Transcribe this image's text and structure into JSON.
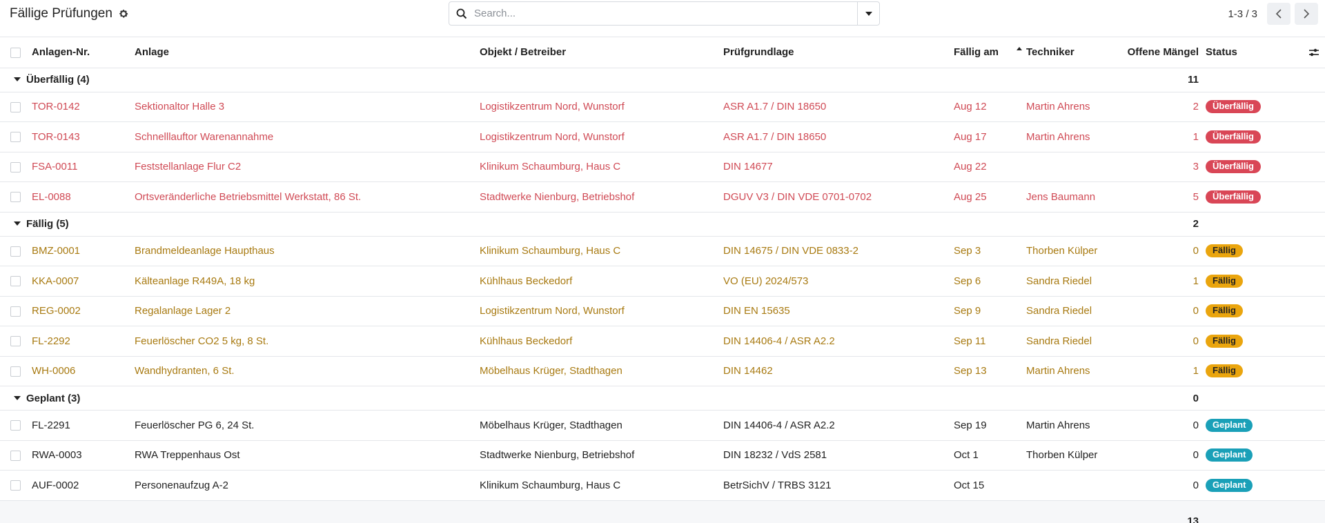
{
  "header": {
    "title": "Fällige Prüfungen",
    "search_placeholder": "Search...",
    "pager_value": "1-3 / 3"
  },
  "columns": {
    "asset_no": "Anlagen-Nr.",
    "asset": "Anlage",
    "site": "Objekt / Betreiber",
    "basis": "Prüfgrundlage",
    "due": "Fällig am",
    "tech": "Techniker",
    "defects": "Offene Mängel",
    "status": "Status"
  },
  "groups": [
    {
      "label": "Überfällig (4)",
      "total": "11",
      "rows": [
        {
          "no": "TOR-0142",
          "asset": "Sektionaltor Halle 3",
          "site": "Logistikzentrum Nord, Wunstorf",
          "basis": "ASR A1.7 / DIN 18650",
          "due": "Aug 12",
          "tech": "Martin Ahrens",
          "defects": "2",
          "status": "Überfällig"
        },
        {
          "no": "TOR-0143",
          "asset": "Schnelllauftor Warenannahme",
          "site": "Logistikzentrum Nord, Wunstorf",
          "basis": "ASR A1.7 / DIN 18650",
          "due": "Aug 17",
          "tech": "Martin Ahrens",
          "defects": "1",
          "status": "Überfällig"
        },
        {
          "no": "FSA-0011",
          "asset": "Feststellanlage Flur C2",
          "site": "Klinikum Schaumburg, Haus C",
          "basis": "DIN 14677",
          "due": "Aug 22",
          "tech": "",
          "defects": "3",
          "status": "Überfällig"
        },
        {
          "no": "EL-0088",
          "asset": "Ortsveränderliche Betriebsmittel Werkstatt, 86 St.",
          "site": "Stadtwerke Nienburg, Betriebshof",
          "basis": "DGUV V3 / DIN VDE 0701-0702",
          "due": "Aug 25",
          "tech": "Jens Baumann",
          "defects": "5",
          "status": "Überfällig"
        }
      ]
    },
    {
      "label": "Fällig (5)",
      "total": "2",
      "rows": [
        {
          "no": "BMZ-0001",
          "asset": "Brandmeldeanlage Haupthaus",
          "site": "Klinikum Schaumburg, Haus C",
          "basis": "DIN 14675 / DIN VDE 0833-2",
          "due": "Sep 3",
          "tech": "Thorben Külper",
          "defects": "0",
          "status": "Fällig"
        },
        {
          "no": "KKA-0007",
          "asset": "Kälteanlage R449A, 18 kg",
          "site": "Kühlhaus Beckedorf",
          "basis": "VO (EU) 2024/573",
          "due": "Sep 6",
          "tech": "Sandra Riedel",
          "defects": "1",
          "status": "Fällig"
        },
        {
          "no": "REG-0002",
          "asset": "Regalanlage Lager 2",
          "site": "Logistikzentrum Nord, Wunstorf",
          "basis": "DIN EN 15635",
          "due": "Sep 9",
          "tech": "Sandra Riedel",
          "defects": "0",
          "status": "Fällig"
        },
        {
          "no": "FL-2292",
          "asset": "Feuerlöscher CO2 5 kg, 8 St.",
          "site": "Kühlhaus Beckedorf",
          "basis": "DIN 14406-4 / ASR A2.2",
          "due": "Sep 11",
          "tech": "Sandra Riedel",
          "defects": "0",
          "status": "Fällig"
        },
        {
          "no": "WH-0006",
          "asset": "Wandhydranten, 6 St.",
          "site": "Möbelhaus Krüger, Stadthagen",
          "basis": "DIN 14462",
          "due": "Sep 13",
          "tech": "Martin Ahrens",
          "defects": "1",
          "status": "Fällig"
        }
      ]
    },
    {
      "label": "Geplant (3)",
      "total": "0",
      "rows": [
        {
          "no": "FL-2291",
          "asset": "Feuerlöscher PG 6, 24 St.",
          "site": "Möbelhaus Krüger, Stadthagen",
          "basis": "DIN 14406-4 / ASR A2.2",
          "due": "Sep 19",
          "tech": "Martin Ahrens",
          "defects": "0",
          "status": "Geplant"
        },
        {
          "no": "RWA-0003",
          "asset": "RWA Treppenhaus Ost",
          "site": "Stadtwerke Nienburg, Betriebshof",
          "basis": "DIN 18232 / VdS 2581",
          "due": "Oct 1",
          "tech": "Thorben Külper",
          "defects": "0",
          "status": "Geplant"
        },
        {
          "no": "AUF-0002",
          "asset": "Personenaufzug A-2",
          "site": "Klinikum Schaumburg, Haus C",
          "basis": "BetrSichV / TRBS 3121",
          "due": "Oct 15",
          "tech": "",
          "defects": "0",
          "status": "Geplant"
        }
      ]
    }
  ],
  "footer_total": "13",
  "colors": {
    "overdue": "#d04a55",
    "due": "#a87a11",
    "planned_badge": "#1aa0b8",
    "due_badge": "#eaa50e",
    "overdue_badge": "#d94656"
  }
}
